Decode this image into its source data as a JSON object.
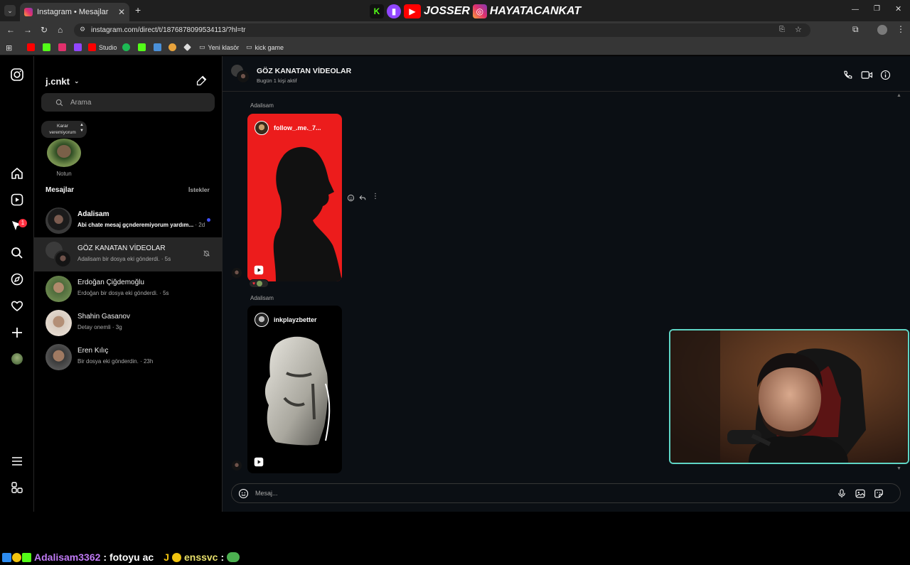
{
  "browser": {
    "tab_title": "Instagram • Mesajlar",
    "url": "instagram.com/direct/t/18768780995341​13/?hl=tr",
    "bookmarks": [
      "Studio",
      "Yeni klasör",
      "kick game"
    ]
  },
  "stream_banner": {
    "name1": "JOSSER",
    "name2": "HAYATACANKAT"
  },
  "instagram": {
    "account": "j.cnkt",
    "search_placeholder": "Arama",
    "note": {
      "bubble": "Karar veremiyorum",
      "label": "Notun"
    },
    "section_title": "Mesajlar",
    "requests_label": "İstekler",
    "threads": [
      {
        "name": "Adalisam",
        "preview": "Abi chate mesaj gçnderemiyorum yardım...",
        "time": "· 2d",
        "unread": true
      },
      {
        "name": "GÖZ KANATAN VİDEOLAR",
        "preview": "Adalisam bir dosya eki gönderdi.",
        "time": "· 5s",
        "muted": true
      },
      {
        "name": "Erdoğan Çiğdemoğlu",
        "preview": "Erdoğan bir dosya eki gönderdi.",
        "time": "· 5s"
      },
      {
        "name": "Shahin Gasanov",
        "preview": "Detay onemli",
        "time": "· 3g"
      },
      {
        "name": "Eren Kılıç",
        "preview": "Bir dosya eki gönderdin.",
        "time": "· 23h"
      }
    ],
    "chat": {
      "title": "GÖZ KANATAN VİDEOLAR",
      "subtitle": "Bugün 1 kişi aktif",
      "messages": [
        {
          "sender": "Adalisam",
          "reel_author": "follow_.me._7..."
        },
        {
          "sender": "Adalisam",
          "reel_author": "inkplayzbetter"
        }
      ],
      "composer_placeholder": "Mesaj..."
    },
    "notification_count": "1"
  },
  "ticker": {
    "user1": "Adalisam3362",
    "msg1": ": fotoyu ac",
    "badge": "J",
    "user2": "enssvc",
    "msg2": ":"
  }
}
